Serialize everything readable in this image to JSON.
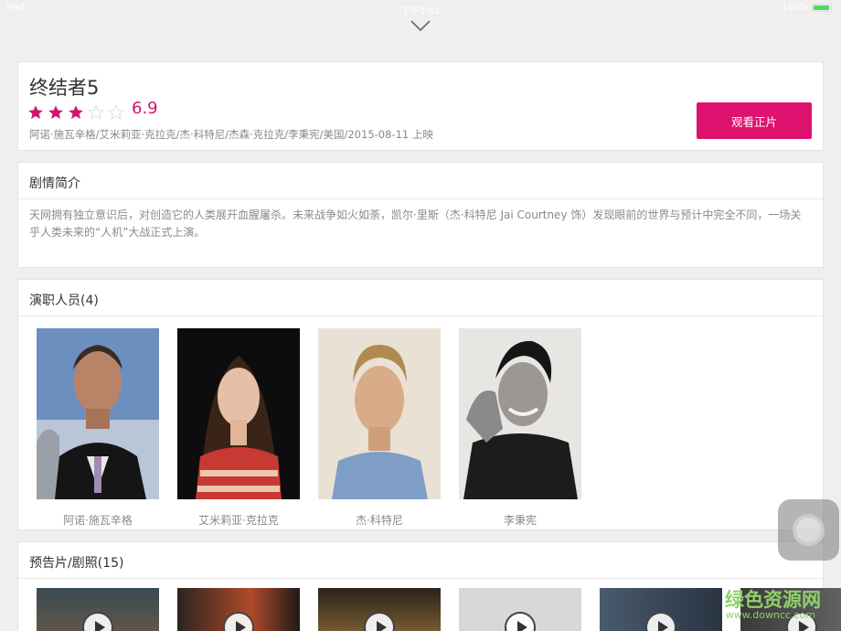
{
  "statusbar": {
    "left": "iPad",
    "center": "下午3:02",
    "right": "100%"
  },
  "movie": {
    "title": "终结者5",
    "rating": 3,
    "rating_max": 5,
    "score": "6.9",
    "meta": "阿诺·施瓦辛格/艾米莉亚·克拉克/杰·科特尼/杰森·克拉克/李秉宪/美国/2015-08-11 上映",
    "watch_label": "观看正片"
  },
  "synopsis": {
    "header": "剧情简介",
    "text": "天网拥有独立意识后，对创造它的人类展开血腥屠杀。未来战争如火如荼，凯尔·里斯（杰·科特尼 Jai Courtney 饰）发现眼前的世界与预计中完全不同，一场关乎人类未来的“人机”大战正式上演。"
  },
  "cast": {
    "header": "演职人员(4)",
    "members": [
      {
        "name": "阿诺·施瓦辛格"
      },
      {
        "name": "艾米莉亚·克拉克"
      },
      {
        "name": "杰·科特尼"
      },
      {
        "name": "李秉宪"
      }
    ]
  },
  "trailers": {
    "header": "预告片/剧照(15)"
  },
  "watermark": {
    "text": "绿色资源网",
    "url": "www.downcc.com"
  },
  "colors": {
    "accent": "#e0126f",
    "score": "#d0146f"
  },
  "icons": [
    "chevron-down-icon",
    "star-icon",
    "play-icon",
    "assistive-touch-icon"
  ]
}
